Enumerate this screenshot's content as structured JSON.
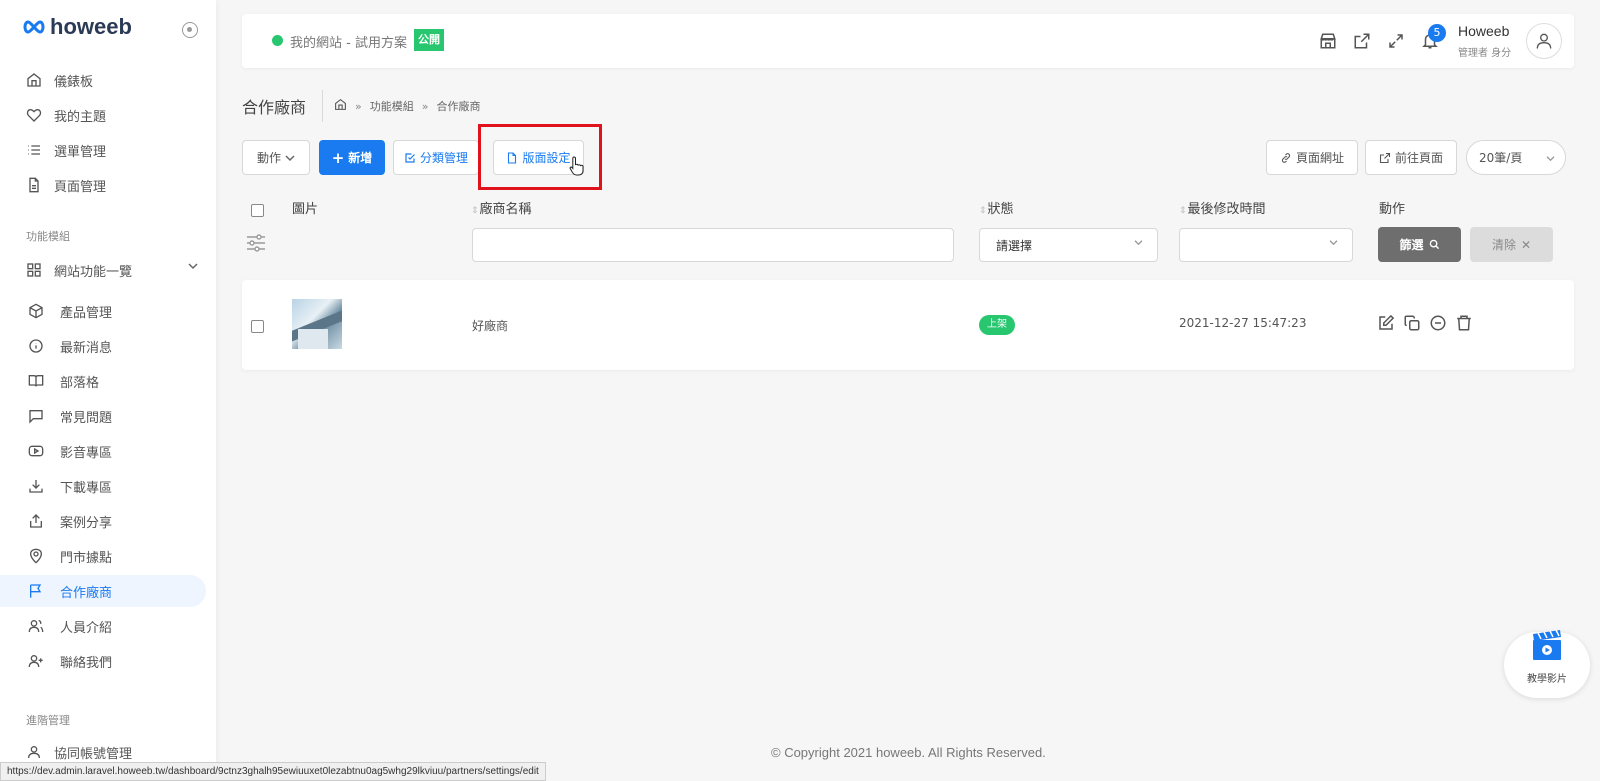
{
  "brand": {
    "logo_mark": "∞",
    "name": "howeeb"
  },
  "sidebar": {
    "items": [
      {
        "label": "儀錶板",
        "icon": "home-icon"
      },
      {
        "label": "我的主題",
        "icon": "heart-icon"
      },
      {
        "label": "選單管理",
        "icon": "list-icon"
      },
      {
        "label": "頁面管理",
        "icon": "file-text-icon"
      }
    ],
    "section_modules": "功能模組",
    "group_label": "網站功能一覽",
    "sub_items": [
      {
        "label": "產品管理",
        "icon": "package-icon"
      },
      {
        "label": "最新消息",
        "icon": "info-icon"
      },
      {
        "label": "部落格",
        "icon": "book-open-icon"
      },
      {
        "label": "常見問題",
        "icon": "message-square-icon"
      },
      {
        "label": "影音專區",
        "icon": "youtube-icon"
      },
      {
        "label": "下載專區",
        "icon": "download-icon"
      },
      {
        "label": "案例分享",
        "icon": "share-icon"
      },
      {
        "label": "門市據點",
        "icon": "map-pin-icon"
      },
      {
        "label": "合作廠商",
        "icon": "flag-icon"
      },
      {
        "label": "人員介紹",
        "icon": "users-icon"
      },
      {
        "label": "聯絡我們",
        "icon": "user-plus-icon"
      }
    ],
    "section_advanced": "進階管理",
    "advanced_items": [
      {
        "label": "協同帳號管理",
        "icon": "user-icon"
      }
    ]
  },
  "topbar": {
    "site_name": "我的網站 - 試用方案",
    "public_badge": "公開",
    "notification_count": "5",
    "user_name": "Howeeb",
    "user_role": "管理者 身分"
  },
  "page": {
    "title": "合作廠商",
    "breadcrumb_module": "功能模組",
    "breadcrumb_current": "合作廠商"
  },
  "toolbar": {
    "actions_label": "動作",
    "add_label": "新增",
    "category_label": "分類管理",
    "layout_label": "版面設定",
    "page_url_label": "頁面網址",
    "goto_page_label": "前往頁面",
    "per_page_label": "20筆/頁"
  },
  "table": {
    "headers": [
      "圖片",
      "廠商名稱",
      "狀態",
      "最後修改時間",
      "動作"
    ],
    "status_placeholder": "請選擇",
    "filter_button": "篩選",
    "clear_button": "清除",
    "rows": [
      {
        "name": "好廠商",
        "status": "上架",
        "modified": "2021-12-27 15:47:23"
      }
    ]
  },
  "footer": {
    "copyright": "© Copyright 2021 howeeb. All Rights Reserved.",
    "status_url": "https://dev.admin.laravel.howeeb.tw/dashboard/9ctnz3ghalh95ewiuuxet0lezabtnu0ag5whg29lkviuu/partners/settings/edit"
  },
  "tutorial": {
    "label": "教學影片"
  },
  "colors": {
    "accent": "#1a7bf0",
    "success": "#28c76f",
    "highlight": "#e0121b"
  }
}
